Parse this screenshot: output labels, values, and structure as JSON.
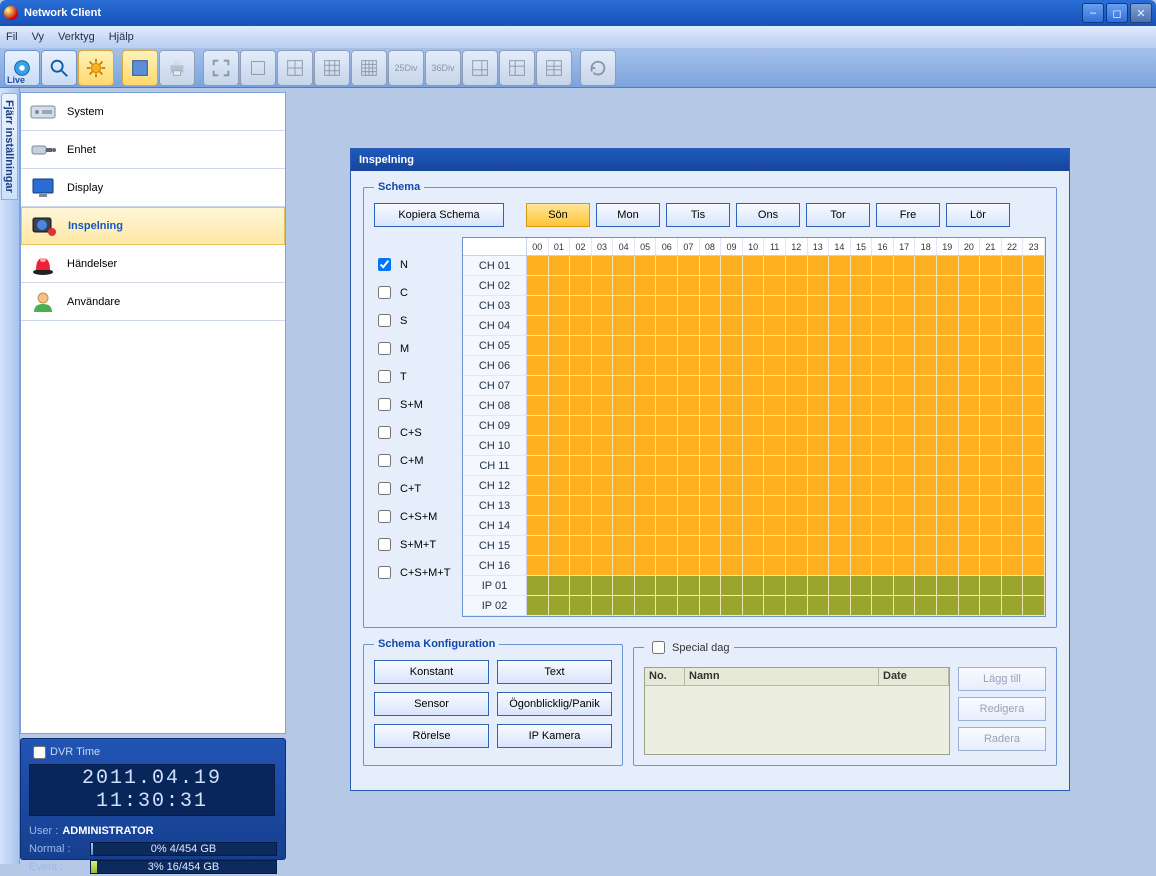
{
  "window": {
    "title": "Network Client"
  },
  "menu": {
    "items": [
      "Fil",
      "Vy",
      "Verktyg",
      "Hjälp"
    ]
  },
  "leftrail": {
    "label": "Fjärr inställningar"
  },
  "sidebar": {
    "items": [
      {
        "label": "System"
      },
      {
        "label": "Enhet"
      },
      {
        "label": "Display"
      },
      {
        "label": "Inspelning"
      },
      {
        "label": "Händelser"
      },
      {
        "label": "Användare"
      }
    ]
  },
  "status": {
    "dvr_label": "DVR Time",
    "clock": "2011.04.19  11:30:31",
    "user_label": "User :",
    "user_value": "ADMINISTRATOR",
    "normal_label": "Normal :",
    "normal_text": "0% 4/454 GB",
    "event_label": "Event  :",
    "event_text": "3% 16/454 GB"
  },
  "panel": {
    "title": "Inspelning",
    "schema_legend": "Schema",
    "copy_btn": "Kopiera Schema",
    "days": [
      "Sön",
      "Mon",
      "Tis",
      "Ons",
      "Tor",
      "Fre",
      "Lör"
    ],
    "modes": [
      "N",
      "C",
      "S",
      "M",
      "T",
      "S+M",
      "C+S",
      "C+M",
      "C+T",
      "C+S+M",
      "S+M+T",
      "C+S+M+T"
    ],
    "hours": [
      "00",
      "01",
      "02",
      "03",
      "04",
      "05",
      "06",
      "07",
      "08",
      "09",
      "10",
      "11",
      "12",
      "13",
      "14",
      "15",
      "16",
      "17",
      "18",
      "19",
      "20",
      "21",
      "22",
      "23"
    ],
    "channels": [
      "CH 01",
      "CH 02",
      "CH 03",
      "CH 04",
      "CH 05",
      "CH 06",
      "CH 07",
      "CH 08",
      "CH 09",
      "CH 10",
      "CH 11",
      "CH 12",
      "CH 13",
      "CH 14",
      "CH 15",
      "CH 16",
      "IP 01",
      "IP 02"
    ],
    "config_legend": "Schema Konfiguration",
    "config_btns": [
      "Konstant",
      "Text",
      "Sensor",
      "Ögonblicklig/Panik",
      "Rörelse",
      "IP Kamera"
    ],
    "special_legend": "Special dag",
    "special_cols": {
      "no": "No.",
      "name": "Namn",
      "date": "Date"
    },
    "special_btns": [
      "Lägg till",
      "Redigera",
      "Radera"
    ]
  }
}
